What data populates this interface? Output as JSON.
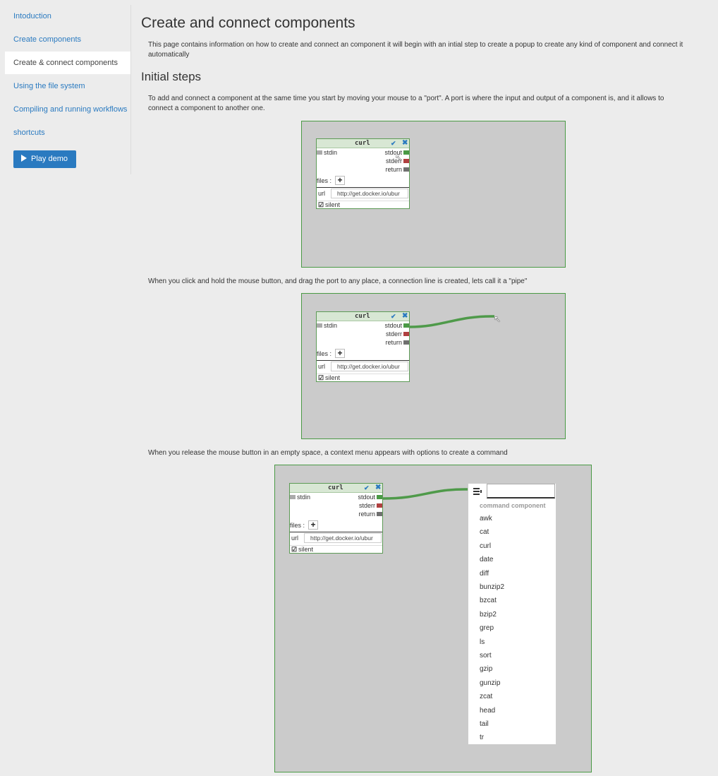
{
  "sidebar": {
    "items": [
      {
        "label": "Intoduction"
      },
      {
        "label": "Create components"
      },
      {
        "label": "Create & connect components"
      },
      {
        "label": "Using the file system"
      },
      {
        "label": "Compiling and running workflows"
      },
      {
        "label": "shortcuts"
      }
    ],
    "active_item": "Create & connect components",
    "play_demo": "Play demo"
  },
  "main": {
    "title": "Create and connect components",
    "intro_line1": "This page contains information on how to create and connect an component it will begin with an intial step to create a popup to create any kind of component and connect it",
    "intro_line2": "automatically",
    "section_title": "Initial steps",
    "step1_line1": "To add and connect a component at the same time you start by moving your mouse to a \"port\". A port is where the input and output of a component is, and it allows to",
    "step1_line2": "connect a component to another one.",
    "step2": "When you click and hold the mouse button, and drag the port to any place, a connection line is created, lets call it a \"pipe\"",
    "step3": "When you release the mouse button in an empty space, a context menu appears with options to create a command"
  },
  "component": {
    "title": "curl",
    "input_port": "stdin",
    "output_ports": [
      "stdout",
      "stderr",
      "return"
    ],
    "files_label": "files :",
    "url_label": "url",
    "url_value": "http://get.docker.io/ubur",
    "silent_label": "silent"
  },
  "colors": {
    "accent": "#2a7ac0",
    "port_stdout": "#4a9a45",
    "port_stderr": "#b04040",
    "port_return": "#707070",
    "pipe": "#4f9a4a",
    "canvas_bg": "#cbcbcb"
  },
  "context_menu": {
    "icon": "list-icon",
    "category": "command component",
    "items": [
      "awk",
      "cat",
      "curl",
      "date",
      "diff",
      "bunzip2",
      "bzcat",
      "bzip2",
      "grep",
      "ls",
      "sort",
      "gzip",
      "gunzip",
      "zcat",
      "head",
      "tail",
      "tr"
    ]
  }
}
